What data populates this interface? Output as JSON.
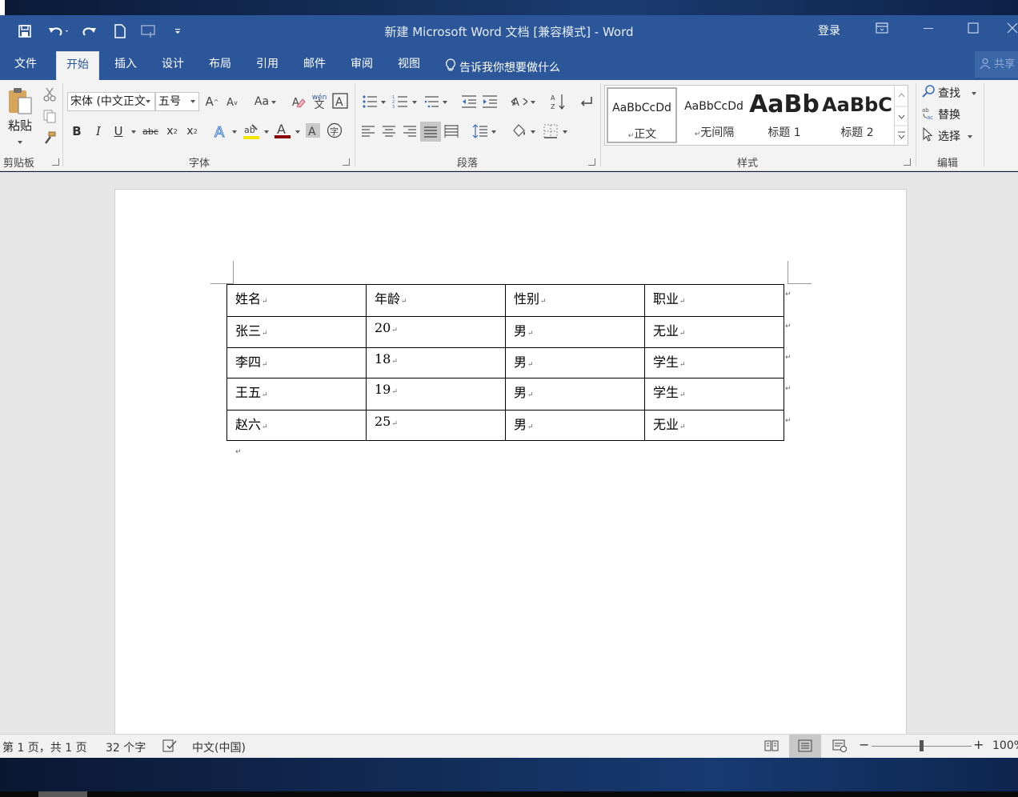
{
  "window": {
    "title": "新建 Microsoft Word 文档 [兼容模式]  -  Word",
    "login_label": "登录"
  },
  "tabs": [
    {
      "label": "文件",
      "active": false
    },
    {
      "label": "开始",
      "active": true
    },
    {
      "label": "插入",
      "active": false
    },
    {
      "label": "设计",
      "active": false
    },
    {
      "label": "布局",
      "active": false
    },
    {
      "label": "引用",
      "active": false
    },
    {
      "label": "邮件",
      "active": false
    },
    {
      "label": "审阅",
      "active": false
    },
    {
      "label": "视图",
      "active": false
    }
  ],
  "tell_me": "告诉我你想要做什么",
  "share_label": "共享",
  "ribbon": {
    "clipboard": {
      "paste_label": "粘贴",
      "group_label": "剪贴板"
    },
    "font": {
      "font_name": "宋体 (中文正文",
      "font_size": "五号",
      "change_case": "Aa",
      "phonetic": "wén",
      "group_label": "字体",
      "font_color": "#8b0000",
      "highlight_color": "#f2e600"
    },
    "paragraph": {
      "group_label": "段落"
    },
    "styles": {
      "group_label": "样式",
      "items": [
        {
          "preview": "AaBbCcDd",
          "name": "正文",
          "selected": true
        },
        {
          "preview": "AaBbCcDd",
          "name": "无间隔",
          "selected": false
        },
        {
          "preview": "AaBb",
          "name": "标题 1",
          "selected": false
        },
        {
          "preview": "AaBbC",
          "name": "标题 2",
          "selected": false
        }
      ]
    },
    "editing": {
      "group_label": "编辑",
      "find_label": "查找",
      "replace_label": "替换",
      "select_label": "选择"
    }
  },
  "document": {
    "table": {
      "headers": [
        "姓名",
        "年龄",
        "性别",
        "职业"
      ],
      "rows": [
        [
          "张三",
          "20",
          "男",
          "无业"
        ],
        [
          "李四",
          "18",
          "男",
          "学生"
        ],
        [
          "王五",
          "19",
          "男",
          "学生"
        ],
        [
          "赵六",
          "25",
          "男",
          "无业"
        ]
      ]
    },
    "paragraph_mark": "↵"
  },
  "status": {
    "page_info": "第 1 页，共 1 页",
    "word_count": "32 个字",
    "language": "中文(中国)",
    "zoom": "100%"
  },
  "colors": {
    "accent": "#2b579a"
  }
}
